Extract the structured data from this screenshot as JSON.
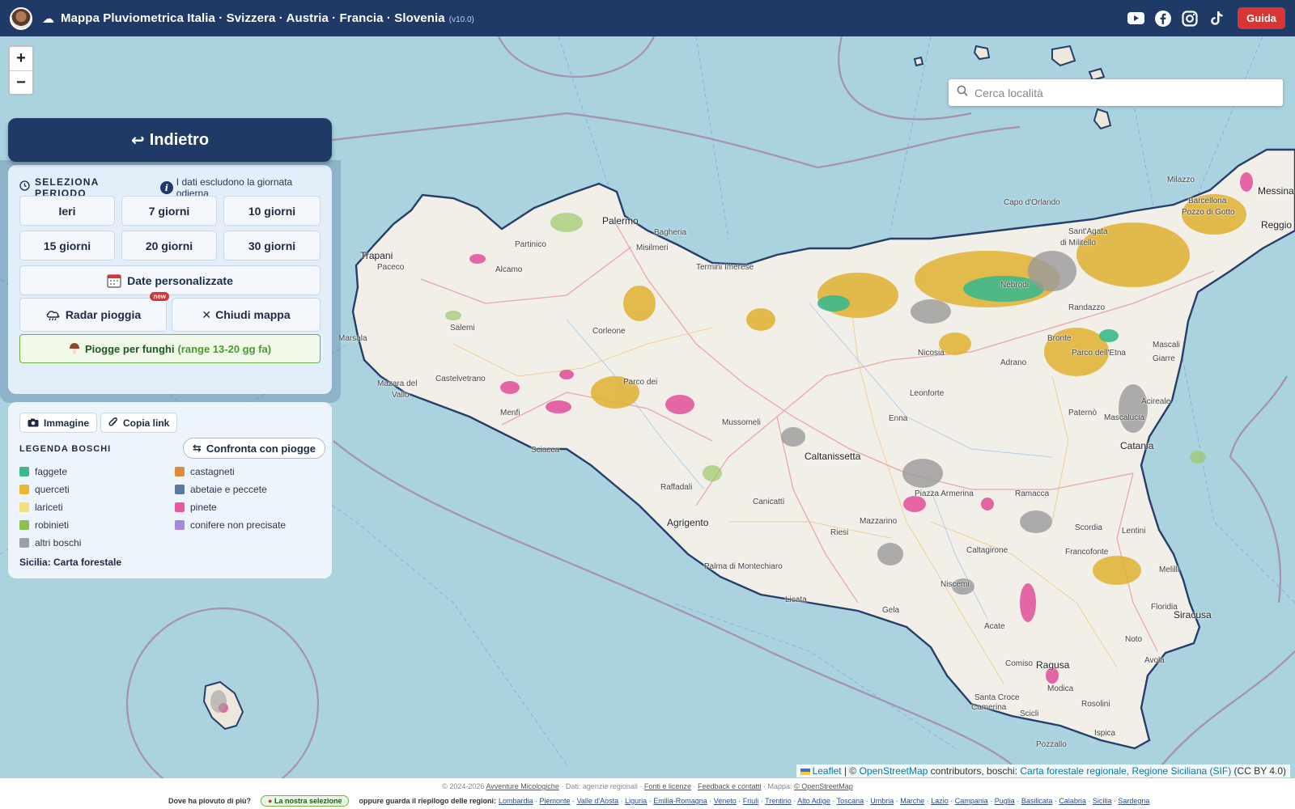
{
  "header": {
    "title": "Mappa Pluviometrica Italia · Svizzera · Austria · Francia · Slovenia",
    "version": "(v10.0)",
    "guide_label": "Guida",
    "social_icons": [
      "youtube-icon",
      "facebook-icon",
      "instagram-icon",
      "tiktok-icon"
    ]
  },
  "search": {
    "placeholder": "Cerca località"
  },
  "zoom": {
    "in_label": "+",
    "out_label": "−"
  },
  "panel": {
    "back_label": "Indietro",
    "period_title": "SELEZIONA PERIODO",
    "period_note": "I dati escludono la giornata odierna",
    "periods": [
      "Ieri",
      "7 giorni",
      "10 giorni",
      "15 giorni",
      "20 giorni",
      "30 giorni"
    ],
    "custom_dates_label": "Date personalizzate",
    "radar_label": "Radar pioggia",
    "radar_badge": "new",
    "close_map_label": "Chiudi mappa",
    "funghi_label": "Piogge per funghi",
    "funghi_range": "(range 13-20 gg fa)"
  },
  "legend": {
    "image_label": "Immagine",
    "copy_link_label": "Copia link",
    "title": "LEGENDA BOSCHI",
    "compare_label": "Confronta con piogge",
    "items": [
      {
        "label": "faggete",
        "color": "#3cb88a"
      },
      {
        "label": "castagneti",
        "color": "#e08a3c"
      },
      {
        "label": "querceti",
        "color": "#e8b830"
      },
      {
        "label": "abetaie e peccete",
        "color": "#5a7a9c"
      },
      {
        "label": "lariceti",
        "color": "#f2e07a"
      },
      {
        "label": "pinete",
        "color": "#e85aa0"
      },
      {
        "label": "robinieti",
        "color": "#8cc050"
      },
      {
        "label": "conifere non precisate",
        "color": "#a888d8"
      },
      {
        "label": "altri boschi",
        "color": "#a0a0a0"
      }
    ],
    "source": "Sicilia: Carta forestale"
  },
  "map": {
    "places": [
      {
        "name": "Palermo",
        "big": true
      },
      {
        "name": "Bagheria"
      },
      {
        "name": "Misilmeri"
      },
      {
        "name": "Termini Imerese"
      },
      {
        "name": "Capo d'Orlando"
      },
      {
        "name": "Milazzo"
      },
      {
        "name": "Messina",
        "big": true
      },
      {
        "name": "Reggio",
        "big": true
      },
      {
        "name": "Barcellona"
      },
      {
        "name": "Pozzo di Gotto"
      },
      {
        "name": "Sant'Agata"
      },
      {
        "name": "di Militello"
      },
      {
        "name": "Trapani",
        "big": true
      },
      {
        "name": "Paceco"
      },
      {
        "name": "Partinico"
      },
      {
        "name": "Alcamo"
      },
      {
        "name": "Salemi"
      },
      {
        "name": "Corleone"
      },
      {
        "name": "Marsala"
      },
      {
        "name": "Mazara del"
      },
      {
        "name": "Vallo"
      },
      {
        "name": "Castelvetrano"
      },
      {
        "name": "Menfi"
      },
      {
        "name": "Sciacca"
      },
      {
        "name": "Nebrodi"
      },
      {
        "name": "Randazzo"
      },
      {
        "name": "Nicosia"
      },
      {
        "name": "Bronte"
      },
      {
        "name": "Adrano"
      },
      {
        "name": "Parco dell'Etna"
      },
      {
        "name": "Giarre"
      },
      {
        "name": "Mascali"
      },
      {
        "name": "Leonforte"
      },
      {
        "name": "Enna"
      },
      {
        "name": "Paternò"
      },
      {
        "name": "Acireale"
      },
      {
        "name": "Mascalucia"
      },
      {
        "name": "Catania",
        "big": true
      },
      {
        "name": "Mussomeli"
      },
      {
        "name": "Caltanissetta",
        "big": true
      },
      {
        "name": "Raffadali"
      },
      {
        "name": "Agrigento",
        "big": true
      },
      {
        "name": "Canicattì"
      },
      {
        "name": "Piazza Armerina"
      },
      {
        "name": "Ramacca"
      },
      {
        "name": "Riesi"
      },
      {
        "name": "Mazzarino"
      },
      {
        "name": "Palma di Montechiaro"
      },
      {
        "name": "Caltagirone"
      },
      {
        "name": "Scordia"
      },
      {
        "name": "Lentini"
      },
      {
        "name": "Francofonte"
      },
      {
        "name": "Licata"
      },
      {
        "name": "Gela"
      },
      {
        "name": "Niscemi"
      },
      {
        "name": "Acate"
      },
      {
        "name": "Melilli"
      },
      {
        "name": "Floridia"
      },
      {
        "name": "Siracusa",
        "big": true
      },
      {
        "name": "Avola"
      },
      {
        "name": "Ragusa",
        "big": true
      },
      {
        "name": "Modica"
      },
      {
        "name": "Comiso"
      },
      {
        "name": "Rosolini"
      },
      {
        "name": "Santa Croce"
      },
      {
        "name": "Camerina"
      },
      {
        "name": "Scicli"
      },
      {
        "name": "Ispica"
      },
      {
        "name": "Pozzallo"
      },
      {
        "name": "Noto"
      },
      {
        "name": "Parco dei"
      }
    ]
  },
  "attribution": {
    "leaflet": "Leaflet",
    "sep": "| ©",
    "osm": "OpenStreetMap",
    "contributors": "contributors, boschi:",
    "carta": "Carta forestale regionale, Regione Siciliana (SIF)",
    "license": "(CC BY 4.0)"
  },
  "footer": {
    "copyright": "© 2024-2026",
    "site": "Avventure Micologiche",
    "data_note": "· Dati: agenzie regionali ·",
    "fonti": "Fonti e licenze",
    "feedback": "Feedback e contatti",
    "mappa": "· Mappa:",
    "osm_link": "© OpenStreetMap",
    "question": "Dove ha piovuto di più?",
    "selection": "La nostra selezione",
    "or_text": "oppure guarda il riepilogo delle regioni:",
    "regions": [
      "Lombardia",
      "Piemonte",
      "Valle d'Aosta",
      "Liguria",
      "Emilia-Romagna",
      "Veneto",
      "Friuli",
      "Trentino",
      "Alto Adige",
      "Toscana",
      "Umbria",
      "Marche",
      "Lazio",
      "Campania",
      "Puglia",
      "Basilicata",
      "Calabria",
      "Sicilia",
      "Sardegna"
    ]
  }
}
